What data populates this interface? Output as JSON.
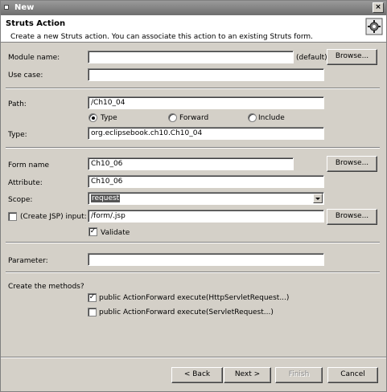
{
  "window": {
    "title": "New",
    "close_glyph": "×"
  },
  "header": {
    "title": "Struts Action",
    "description": "Create a new Struts action. You can associate this action to an existing Struts form.",
    "icon": "wizard-gear-icon"
  },
  "module": {
    "label": "Module name:",
    "value": "",
    "default_text": "(default)",
    "browse_label": "Browse..."
  },
  "use_case": {
    "label": "Use case:",
    "value": ""
  },
  "path": {
    "label": "Path:",
    "value": "/Ch10_04"
  },
  "forward_type": {
    "options": [
      {
        "label": "Type",
        "selected": true
      },
      {
        "label": "Forward",
        "selected": false
      },
      {
        "label": "Include",
        "selected": false
      }
    ]
  },
  "type": {
    "label": "Type:",
    "value": "org.eclipsebook.ch10.Ch10_04"
  },
  "form_name": {
    "label": "Form name",
    "value": "Ch10_06",
    "browse_label": "Browse..."
  },
  "attribute": {
    "label": "Attribute:",
    "value": "Ch10_06"
  },
  "scope": {
    "label": "Scope:",
    "value": "request"
  },
  "input": {
    "checked": false,
    "label": "(Create JSP) input:",
    "value": "/form/.jsp",
    "browse_label": "Browse..."
  },
  "validate": {
    "checked": true,
    "label": "Validate"
  },
  "parameter": {
    "label": "Parameter:",
    "value": ""
  },
  "methods": {
    "label": "Create the methods?",
    "items": [
      {
        "checked": true,
        "label": "public ActionForward execute(HttpServletRequest...)"
      },
      {
        "checked": false,
        "label": "public ActionForward execute(ServletRequest...)"
      }
    ]
  },
  "buttons": {
    "back": "< Back",
    "next": "Next >",
    "finish": "Finish",
    "cancel": "Cancel"
  }
}
